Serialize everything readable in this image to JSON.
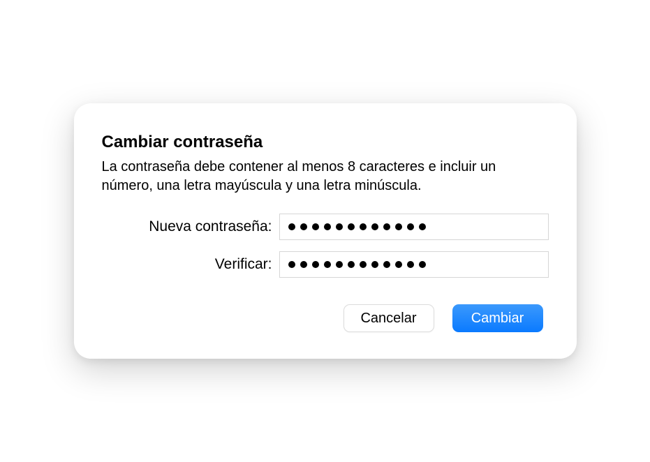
{
  "dialog": {
    "title": "Cambiar contraseña",
    "description": "La contraseña debe contener al menos 8 caracteres e incluir un número, una letra mayúscula y una letra minúscula.",
    "fields": {
      "new_password": {
        "label": "Nueva contraseña:",
        "dot_count": 12
      },
      "verify": {
        "label": "Verificar:",
        "dot_count": 12
      }
    },
    "buttons": {
      "cancel": "Cancelar",
      "confirm": "Cambiar"
    }
  }
}
